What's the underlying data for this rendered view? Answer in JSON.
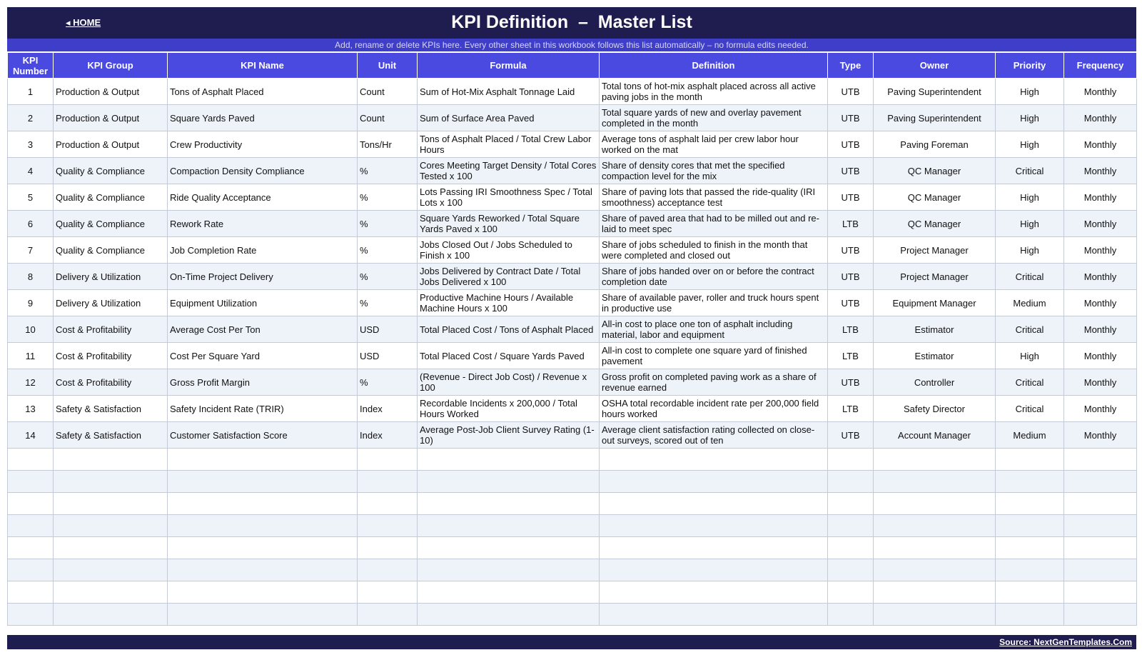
{
  "header": {
    "home_label": "◂ HOME",
    "title": "KPI Definition  –  Master List",
    "subtitle": "Add, rename or delete KPIs here. Every other sheet in this workbook follows this list automatically – no formula edits needed."
  },
  "table": {
    "columns": [
      "KPI Number",
      "KPI Group",
      "KPI Name",
      "Unit",
      "Formula",
      "Definition",
      "Type",
      "Owner",
      "Priority",
      "Frequency"
    ],
    "rows": [
      [
        "1",
        "Production & Output",
        "Tons of Asphalt Placed",
        "Count",
        "Sum of Hot-Mix Asphalt Tonnage Laid",
        "Total tons of hot-mix asphalt placed across all active paving jobs in the month",
        "UTB",
        "Paving Superintendent",
        "High",
        "Monthly"
      ],
      [
        "2",
        "Production & Output",
        "Square Yards Paved",
        "Count",
        "Sum of Surface Area Paved",
        "Total square yards of new and overlay pavement completed in the month",
        "UTB",
        "Paving Superintendent",
        "High",
        "Monthly"
      ],
      [
        "3",
        "Production & Output",
        "Crew Productivity",
        "Tons/Hr",
        "Tons of Asphalt Placed / Total Crew Labor Hours",
        "Average tons of asphalt laid per crew labor hour worked on the mat",
        "UTB",
        "Paving Foreman",
        "High",
        "Monthly"
      ],
      [
        "4",
        "Quality & Compliance",
        "Compaction Density Compliance",
        "%",
        "Cores Meeting Target Density / Total Cores Tested x 100",
        "Share of density cores that met the specified compaction level for the mix",
        "UTB",
        "QC Manager",
        "Critical",
        "Monthly"
      ],
      [
        "5",
        "Quality & Compliance",
        "Ride Quality Acceptance",
        "%",
        "Lots Passing IRI Smoothness Spec / Total Lots x 100",
        "Share of paving lots that passed the ride-quality (IRI smoothness) acceptance test",
        "UTB",
        "QC Manager",
        "High",
        "Monthly"
      ],
      [
        "6",
        "Quality & Compliance",
        "Rework Rate",
        "%",
        "Square Yards Reworked / Total Square Yards Paved x 100",
        "Share of paved area that had to be milled out and re-laid to meet spec",
        "LTB",
        "QC Manager",
        "High",
        "Monthly"
      ],
      [
        "7",
        "Quality & Compliance",
        "Job Completion Rate",
        "%",
        "Jobs Closed Out / Jobs Scheduled to Finish x 100",
        "Share of jobs scheduled to finish in the month that were completed and closed out",
        "UTB",
        "Project Manager",
        "High",
        "Monthly"
      ],
      [
        "8",
        "Delivery & Utilization",
        "On-Time Project Delivery",
        "%",
        "Jobs Delivered by Contract Date / Total Jobs Delivered x 100",
        "Share of jobs handed over on or before the contract completion date",
        "UTB",
        "Project Manager",
        "Critical",
        "Monthly"
      ],
      [
        "9",
        "Delivery & Utilization",
        "Equipment Utilization",
        "%",
        "Productive Machine Hours / Available Machine Hours x 100",
        "Share of available paver, roller and truck hours spent in productive use",
        "UTB",
        "Equipment Manager",
        "Medium",
        "Monthly"
      ],
      [
        "10",
        "Cost & Profitability",
        "Average Cost Per Ton",
        "USD",
        "Total Placed Cost / Tons of Asphalt Placed",
        "All-in cost to place one ton of asphalt including material, labor and equipment",
        "LTB",
        "Estimator",
        "Critical",
        "Monthly"
      ],
      [
        "11",
        "Cost & Profitability",
        "Cost Per Square Yard",
        "USD",
        "Total Placed Cost / Square Yards Paved",
        "All-in cost to complete one square yard of finished pavement",
        "LTB",
        "Estimator",
        "High",
        "Monthly"
      ],
      [
        "12",
        "Cost & Profitability",
        "Gross Profit Margin",
        "%",
        "(Revenue - Direct Job Cost) / Revenue x 100",
        "Gross profit on completed paving work as a share of revenue earned",
        "UTB",
        "Controller",
        "Critical",
        "Monthly"
      ],
      [
        "13",
        "Safety & Satisfaction",
        "Safety Incident Rate (TRIR)",
        "Index",
        "Recordable Incidents x 200,000 / Total Hours Worked",
        "OSHA total recordable incident rate per 200,000 field hours worked",
        "LTB",
        "Safety Director",
        "Critical",
        "Monthly"
      ],
      [
        "14",
        "Safety & Satisfaction",
        "Customer Satisfaction Score",
        "Index",
        "Average Post-Job Client Survey Rating (1-10)",
        "Average client satisfaction rating collected on close-out surveys, scored out of ten",
        "UTB",
        "Account Manager",
        "Medium",
        "Monthly"
      ]
    ],
    "empty_row_count": 8
  },
  "footer": {
    "source": "Source: NextGenTemplates.Com"
  }
}
